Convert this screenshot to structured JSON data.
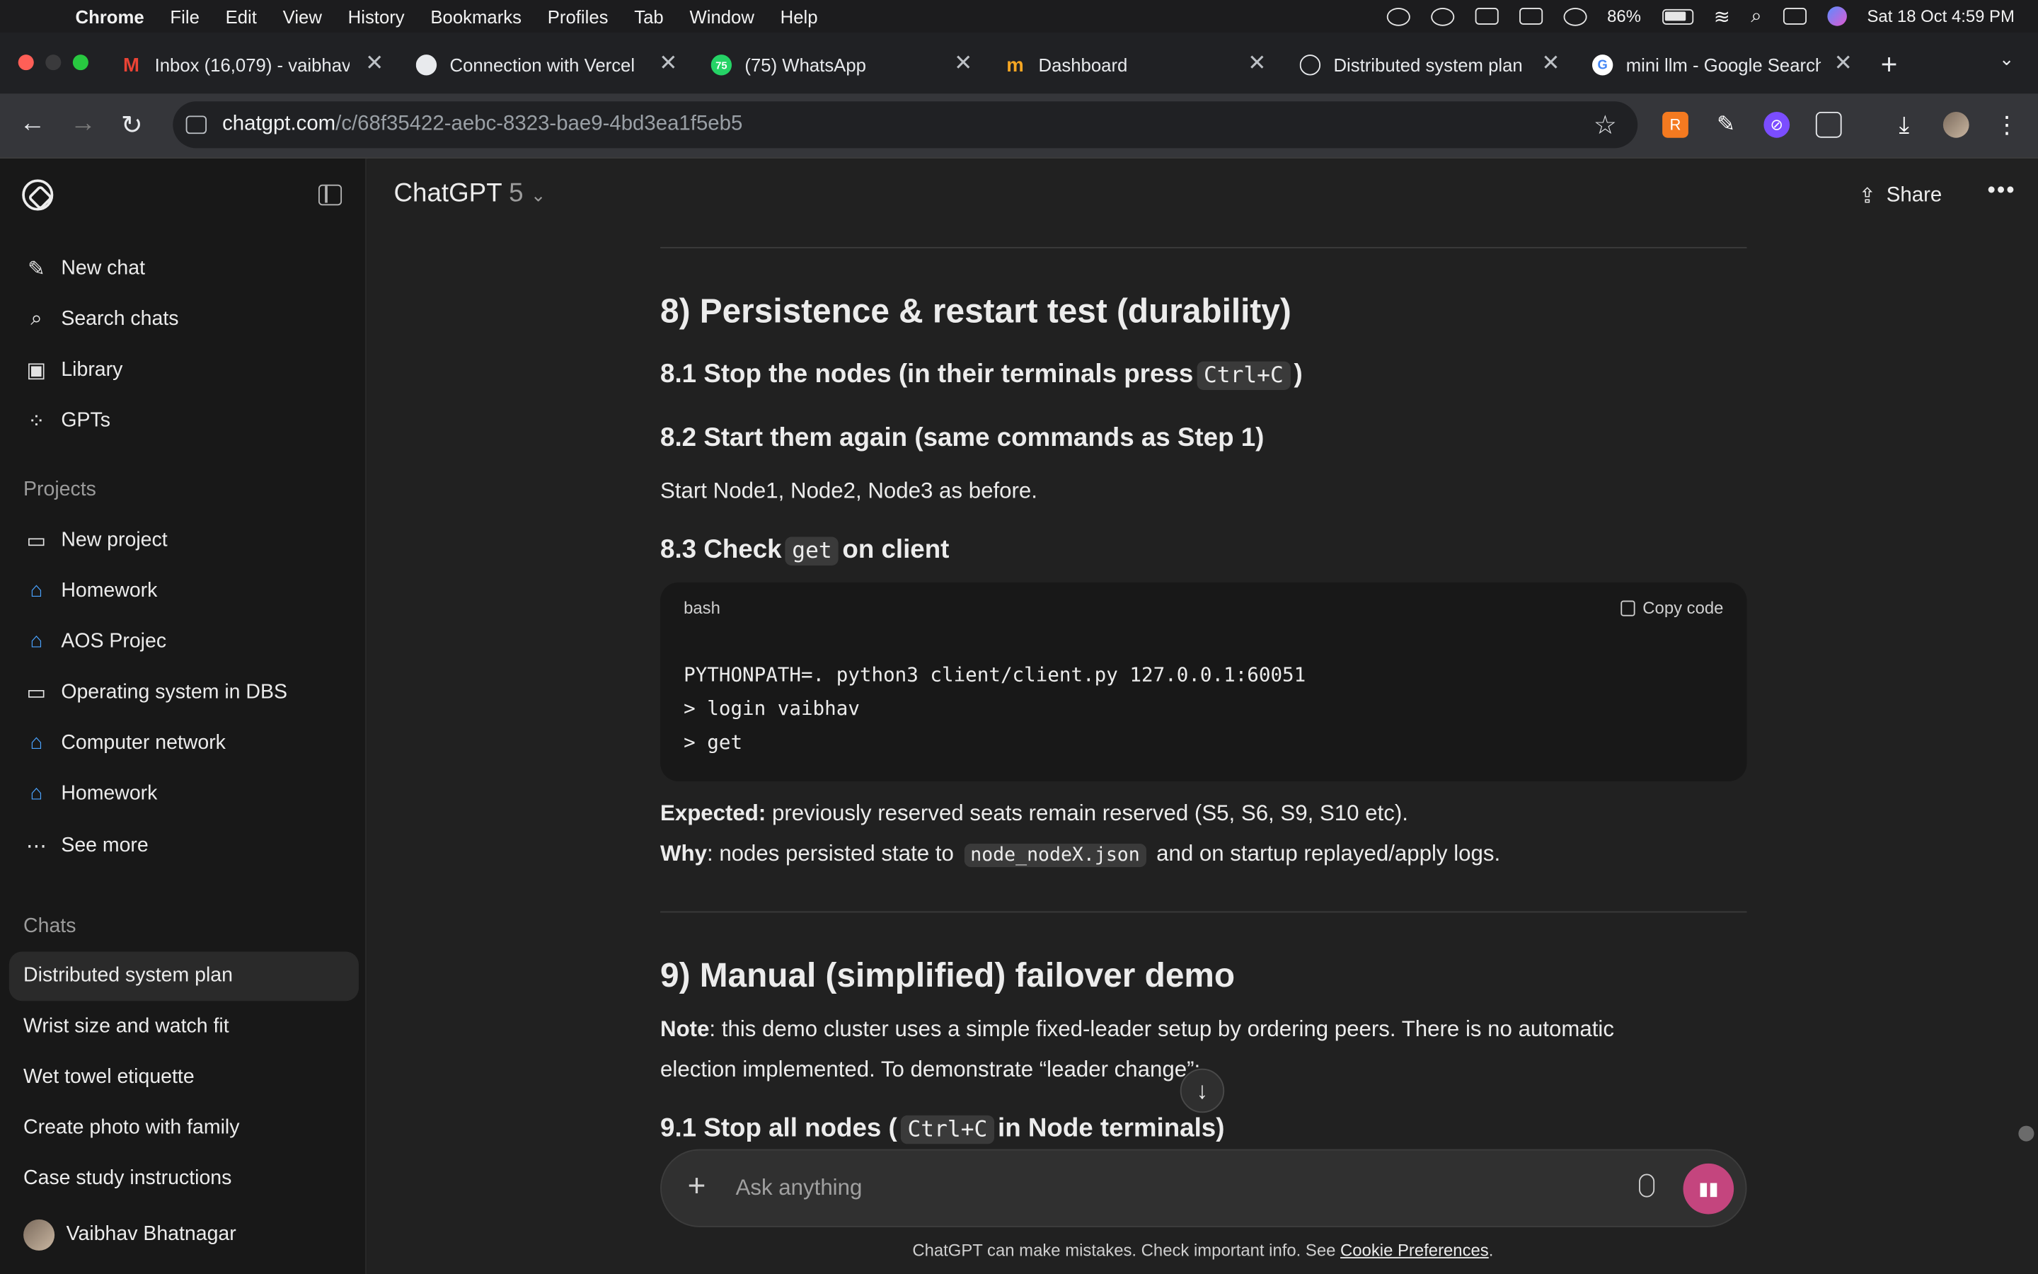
{
  "menubar": {
    "items": [
      "Chrome",
      "File",
      "Edit",
      "View",
      "History",
      "Bookmarks",
      "Profiles",
      "Tab",
      "Window",
      "Help"
    ],
    "battery": "86%",
    "datetime": "Sat 18 Oct  4:59 PM"
  },
  "tabs": [
    {
      "title": "Inbox (16,079) - vaibhav",
      "favicon": "gmail-icon",
      "badge": "M"
    },
    {
      "title": "Connection with Vercel",
      "favicon": "github-icon",
      "badge": ""
    },
    {
      "title": "(75) WhatsApp",
      "favicon": "whatsapp-icon",
      "badge": "75"
    },
    {
      "title": "Dashboard",
      "favicon": "dashboard-icon",
      "badge": "m"
    },
    {
      "title": "Distributed system plan",
      "favicon": "chatgpt-icon",
      "badge": ""
    },
    {
      "title": "mini llm - Google Search",
      "favicon": "google-icon",
      "badge": "G"
    }
  ],
  "address": {
    "host": "chatgpt.com",
    "path": "/c/68f35422-aebc-8323-bae9-4bd3ea1f5eb5"
  },
  "sidebar": {
    "top_items": [
      "New chat",
      "Search chats",
      "Library",
      "GPTs"
    ],
    "projects_header": "Projects",
    "projects": [
      "New project",
      "Homework",
      "AOS Projec",
      "Operating system in DBS",
      "Computer network",
      "Homework",
      "See more"
    ],
    "chats_header": "Chats",
    "chats": [
      "Distributed system plan",
      "Wrist size and watch fit",
      "Wet towel etiquette",
      "Create photo with family",
      "Case study instructions"
    ],
    "user_name": "Vaibhav Bhatnagar"
  },
  "header": {
    "model": "ChatGPT",
    "model_version": "5",
    "share_label": "Share"
  },
  "content": {
    "h8": "8) Persistence & restart test (durability)",
    "h8_1_pre": "8.1 Stop the nodes (in their terminals press",
    "h8_1_code": "Ctrl+C",
    "h8_1_post": ")",
    "h8_2": "8.2 Start them again (same commands as Step 1)",
    "p8_2": "Start Node1, Node2, Node3 as before.",
    "h8_3_pre": "8.3 Check",
    "h8_3_code": "get",
    "h8_3_post": "on client",
    "code_lang": "bash",
    "copy_label": "Copy code",
    "code_text": "PYTHONPATH=. python3 client/client.py 127.0.0.1:60051\n> login vaibhav\n> get",
    "expected_label": "Expected:",
    "expected_text": " previously reserved seats remain reserved (S5, S6, S9, S10 etc).",
    "why_label": "Why",
    "why_pre": ": nodes persisted state to",
    "why_code": "node_nodeX.json",
    "why_post": "and on startup replayed/apply logs.",
    "h9": "9) Manual (simplified) failover demo",
    "note_label": "Note",
    "note_line1": ": this demo cluster uses a simple fixed-leader setup by ordering peers. There is no automatic",
    "note_line2": "election implemented. To demonstrate “leader change”:",
    "h9_1_pre": "9.1 Stop all nodes (",
    "h9_1_code": "Ctrl+C",
    "h9_1_post": "in Node terminals)"
  },
  "composer": {
    "placeholder": "Ask anything"
  },
  "footer": {
    "text": "ChatGPT can make mistakes. Check important info. See ",
    "link": "Cookie Preferences",
    "end": "."
  }
}
